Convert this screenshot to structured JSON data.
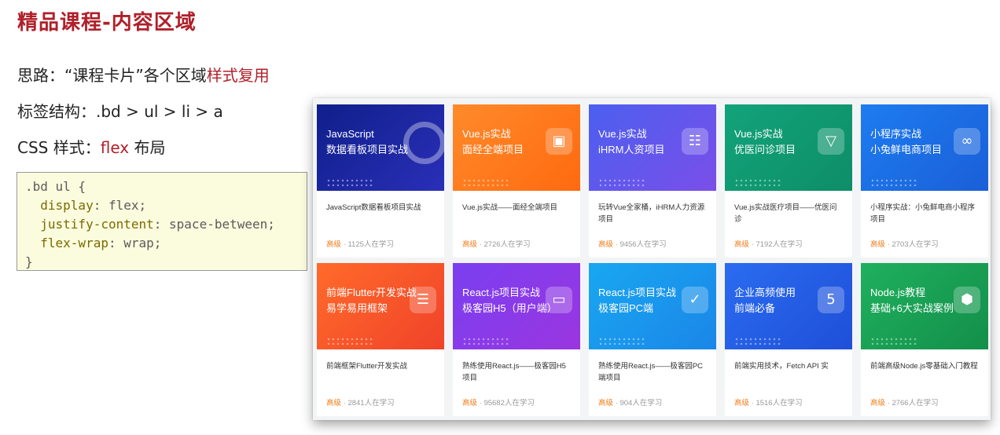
{
  "page": {
    "title": "精品课程-内容区域",
    "line1_prefix": "思路：“课程卡片”各个区域",
    "line1_highlight": "样式复用",
    "line2": "标签结构：.bd > ul > li > a",
    "line3_prefix": "CSS 样式：",
    "line3_highlight": "flex",
    "line3_suffix": " 布局"
  },
  "code": {
    "l1": ".bd ul {",
    "l2_prop": "  display",
    "l2_val": ": flex;",
    "l3_prop": "  justify-content",
    "l3_val": ": space-between;",
    "l4_prop": "  flex-wrap",
    "l4_val": ": wrap;",
    "l5": "}"
  },
  "courses": [
    {
      "cover_title_1": "JavaScript",
      "cover_title_2": "数据看板项目实战",
      "desc": "JavaScript数据看板项目实战",
      "level": "高级",
      "count": " · 1125人在学习",
      "bg_from": "#0f1f8a",
      "bg_to": "#2a2fb8",
      "icon": "ring-icon"
    },
    {
      "cover_title_1": "Vue.js实战",
      "cover_title_2": "面经全端项目",
      "desc": "Vue.js实战——面经全端项目",
      "level": "高级",
      "count": " · 2726人在学习",
      "bg_from": "#ff8a2a",
      "bg_to": "#ff6a10",
      "icon": "briefcase-icon"
    },
    {
      "cover_title_1": "Vue.js实战",
      "cover_title_2": "iHRM人资项目",
      "desc": "玩转Vue全家桶，iHRM人力资源项目",
      "level": "高级",
      "count": " · 9456人在学习",
      "bg_from": "#4b5ff0",
      "bg_to": "#7a4fe8",
      "icon": "grid-icon"
    },
    {
      "cover_title_1": "Vue.js实战",
      "cover_title_2": "优医问诊项目",
      "desc": "Vue.js实战医疗项目——优医问诊",
      "level": "高级",
      "count": " · 7192人在学习",
      "bg_from": "#12a37a",
      "bg_to": "#0e8e68",
      "icon": "vue-logo-icon"
    },
    {
      "cover_title_1": "小程序实战",
      "cover_title_2": "小兔鲜电商项目",
      "desc": "小程序实战：小兔鲜电商小程序项目",
      "level": "高级",
      "count": " · 2703人在学习",
      "bg_from": "#1e7cf0",
      "bg_to": "#1a5fd8",
      "icon": "miniprogram-icon"
    },
    {
      "cover_title_1": "前端Flutter开发实战",
      "cover_title_2": "易学易用框架",
      "desc": "前端框架Flutter开发实战",
      "level": "高级",
      "count": " · 2841人在学习",
      "bg_from": "#ff6a2a",
      "bg_to": "#f0432a",
      "icon": "flutter-icon"
    },
    {
      "cover_title_1": "React.js项目实战",
      "cover_title_2": "极客园H5（用户端）",
      "desc": "熟练使用React.js——极客园H5项目",
      "level": "高级",
      "count": " · 95682人在学习",
      "bg_from": "#7a3ff0",
      "bg_to": "#9a36e0",
      "icon": "monitor-icon"
    },
    {
      "cover_title_1": "React.js项目实战",
      "cover_title_2": "极客园PC端",
      "desc": "熟练使用React.js——极客园PC端项目",
      "level": "高级",
      "count": " · 904人在学习",
      "bg_from": "#19a7f0",
      "bg_to": "#1a86e8",
      "icon": "check-icon"
    },
    {
      "cover_title_1": "企业高频使用",
      "cover_title_2": "前端必备",
      "desc": "前端实用技术，Fetch API 实",
      "level": "高级",
      "count": " · 1516人在学习",
      "bg_from": "#2a6cf0",
      "bg_to": "#1f4fd8",
      "icon": "html5-icon"
    },
    {
      "cover_title_1": "Node.js教程",
      "cover_title_2": "基础+6大实战案例",
      "desc": "前端高级Node.js零基础入门教程",
      "level": "高级",
      "count": " · 2766人在学习",
      "bg_from": "#1fb05e",
      "bg_to": "#138f4a",
      "icon": "nodejs-icon"
    }
  ]
}
